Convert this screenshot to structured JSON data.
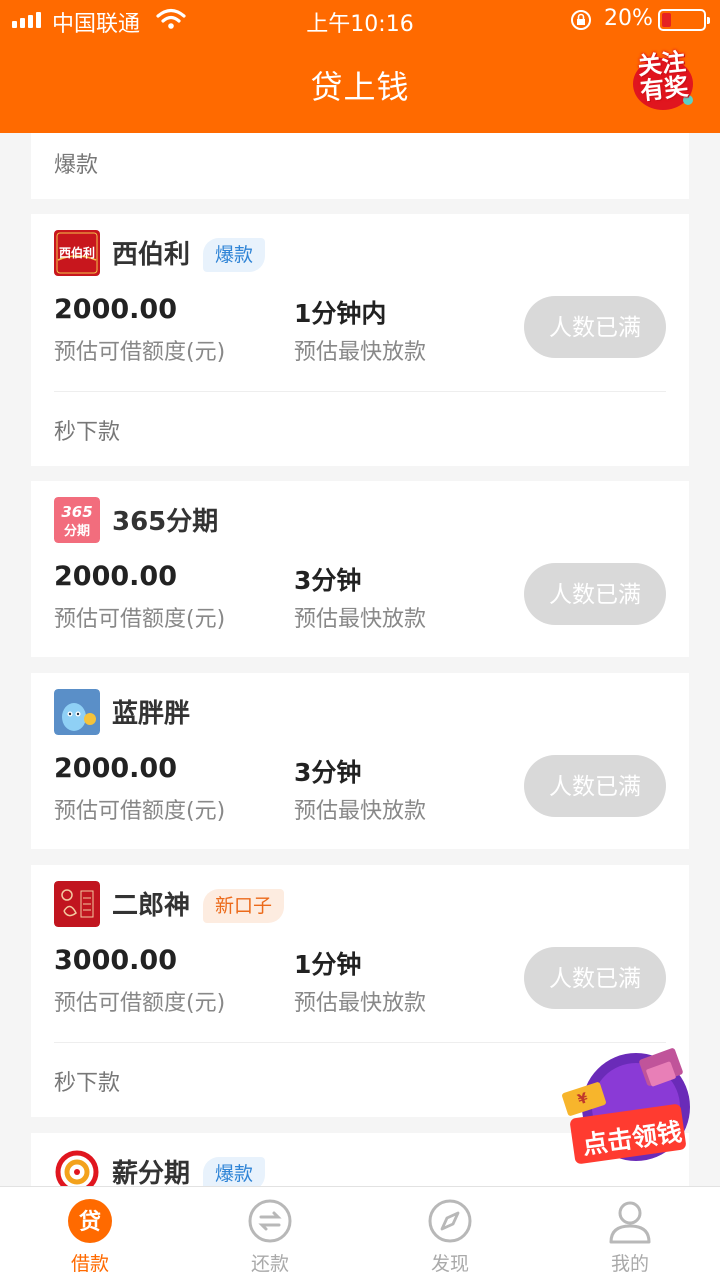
{
  "status_bar": {
    "carrier": "中国联通",
    "time": "上午10:16",
    "battery": "20%"
  },
  "header": {
    "title": "贷上钱",
    "promo_badge": "关注有奖"
  },
  "partial_card": {
    "footnote": "爆款"
  },
  "loan_common": {
    "amount_label": "预估可借额度(元)",
    "speed_label": "预估最快放款",
    "button_label": "人数已满"
  },
  "loans": [
    {
      "name": "西伯利",
      "logo_text": "西伯利",
      "tag": "爆款",
      "tag_type": "hot",
      "amount": "2000.00",
      "speed": "1分钟内",
      "footnote": "秒下款"
    },
    {
      "name": "365分期",
      "logo_text": "365分期",
      "tag": "",
      "amount": "2000.00",
      "speed": "3分钟",
      "footnote": ""
    },
    {
      "name": "蓝胖胖",
      "logo_text": "",
      "tag": "",
      "amount": "2000.00",
      "speed": "3分钟",
      "footnote": ""
    },
    {
      "name": "二郎神",
      "logo_text": "",
      "tag": "新口子",
      "tag_type": "new",
      "amount": "3000.00",
      "speed": "1分钟",
      "footnote": "秒下款"
    },
    {
      "name": "薪分期",
      "logo_text": "",
      "tag": "爆款",
      "tag_type": "hot"
    }
  ],
  "float_promo": {
    "label": "点击领钱"
  },
  "tabbar": {
    "items": [
      {
        "label": "借款",
        "icon": "loan-icon",
        "active": true
      },
      {
        "label": "还款",
        "icon": "repay-icon",
        "active": false
      },
      {
        "label": "发现",
        "icon": "compass-icon",
        "active": false
      },
      {
        "label": "我的",
        "icon": "user-icon",
        "active": false
      }
    ]
  },
  "colors": {
    "brand": "#ff6a00",
    "button_disabled": "#d9d9d9",
    "hot_tag": "#2f84d6",
    "new_tag": "#ec6a1a"
  }
}
